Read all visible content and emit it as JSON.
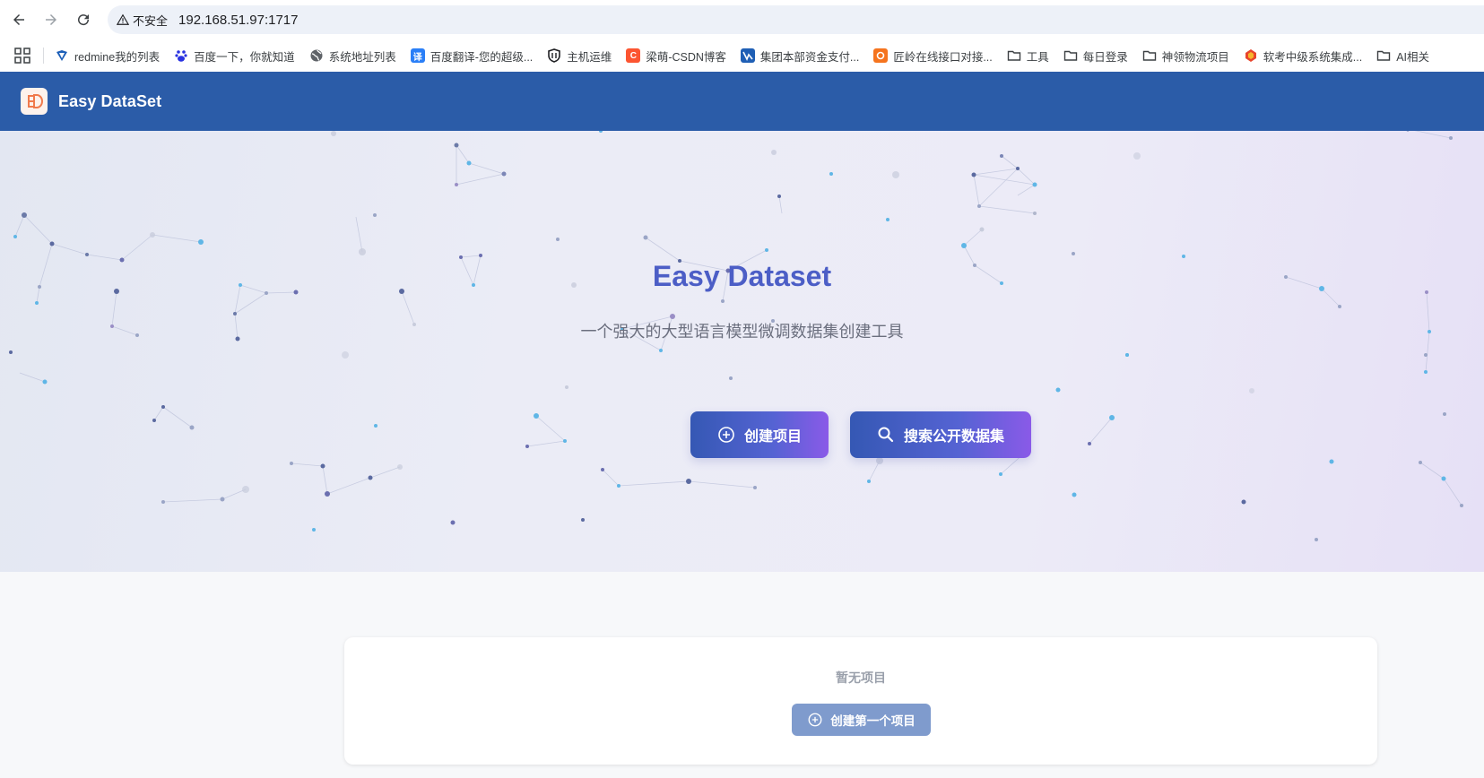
{
  "browser": {
    "security_label": "不安全",
    "url": "192.168.51.97:1717",
    "bookmarks": [
      {
        "label": "redmine我的列表",
        "icon": "redmine-icon"
      },
      {
        "label": "百度一下，你就知道",
        "icon": "baidu-icon"
      },
      {
        "label": "系统地址列表",
        "icon": "globe-icon"
      },
      {
        "label": "百度翻译-您的超级...",
        "icon": "translate-icon"
      },
      {
        "label": "主机运维",
        "icon": "shield-icon"
      },
      {
        "label": "梁萌-CSDN博客",
        "icon": "csdn-icon"
      },
      {
        "label": "集团本部资金支付...",
        "icon": "payment-icon"
      },
      {
        "label": "匠岭在线接口对接...",
        "icon": "orange-app-icon"
      },
      {
        "label": "工具",
        "icon": "folder-icon"
      },
      {
        "label": "每日登录",
        "icon": "folder-icon"
      },
      {
        "label": "神领物流项目",
        "icon": "folder-icon"
      },
      {
        "label": "软考中级系统集成...",
        "icon": "ruankao-icon"
      },
      {
        "label": "AI相关",
        "icon": "folder-icon"
      }
    ]
  },
  "header": {
    "title": "Easy DataSet",
    "logo_icon": "easy-dataset-logo-icon",
    "background": "#2b5ca8"
  },
  "hero": {
    "title": "Easy Dataset",
    "subtitle": "一个强大的大型语言模型微调数据集创建工具",
    "create_button": "创建项目",
    "search_button": "搜索公开数据集",
    "title_color": "#4c5ec6"
  },
  "projects": {
    "empty_text": "暂无项目",
    "create_first_button": "创建第一个项目"
  }
}
